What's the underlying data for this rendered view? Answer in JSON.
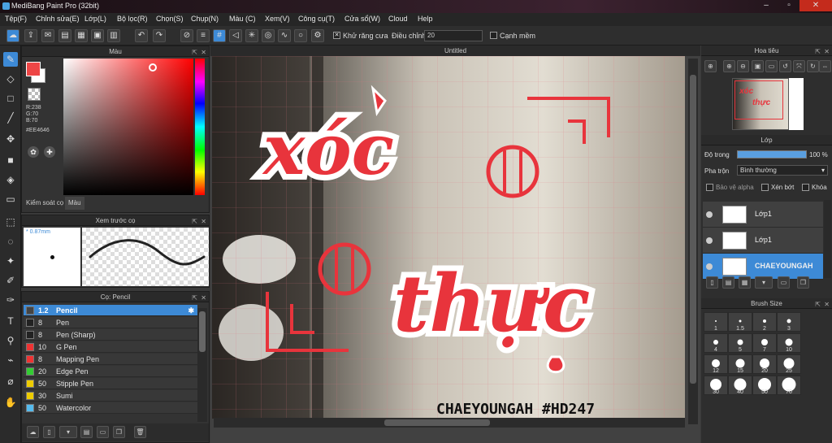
{
  "app": {
    "title": "MediBang Paint Pro (32bit)"
  },
  "menu": [
    "Tệp(F)",
    "Chỉnh sửa(E)",
    "Lớp(L)",
    "Bộ lọc(R)",
    "Chọn(S)",
    "Chụp(N)",
    "Màu (C)",
    "Xem(V)",
    "Công cụ(T)",
    "Cửa sổ(W)",
    "Cloud",
    "Help"
  ],
  "toolbar": {
    "antialias_label": "Khử răng cưa",
    "adjust_label": "Điều chỉnh",
    "adjust_value": "20",
    "sharp_edge_label": "Cạnh mềm"
  },
  "color_panel": {
    "title": "Màu",
    "r": "R:238",
    "g": "G:70",
    "b": "B:70",
    "hex": "#EE4646",
    "fg_color": "#EE4646",
    "tab_control": "Kiểm soát cọ",
    "tab_color": "Màu"
  },
  "brush_preview": {
    "title": "Xem trước cọ",
    "size": "0.87mm"
  },
  "brush_panel": {
    "title": "Cọ: Pencil",
    "brushes": [
      {
        "size": "1.2",
        "name": "Pencil",
        "color": "#444444"
      },
      {
        "size": "8",
        "name": "Pen",
        "color": "#222222"
      },
      {
        "size": "8",
        "name": "Pen (Sharp)",
        "color": "#222222"
      },
      {
        "size": "10",
        "name": "G Pen",
        "color": "#ee3333"
      },
      {
        "size": "8",
        "name": "Mapping Pen",
        "color": "#ee3333"
      },
      {
        "size": "20",
        "name": "Edge Pen",
        "color": "#33cc33"
      },
      {
        "size": "50",
        "name": "Stipple Pen",
        "color": "#eecc00"
      },
      {
        "size": "30",
        "name": "Sumi",
        "color": "#eecc00"
      },
      {
        "size": "50",
        "name": "Watercolor",
        "color": "#55bbee"
      }
    ]
  },
  "canvas": {
    "title": "Untitled",
    "word1": "xóc",
    "word2": "thực",
    "signature": "CHAEYOUNGAH #HD247",
    "accent": "#e8343c"
  },
  "navigator": {
    "title": "Hoa tiêu"
  },
  "layer_panel": {
    "title": "Lớp",
    "opacity_label": "Độ trong",
    "opacity_value": "100 %",
    "opacity": 1.0,
    "blend_label": "Pha trộn",
    "blend_value": "Bình thường",
    "protect_alpha": "Bảo vệ alpha",
    "clipping": "Xén bớt",
    "lock": "Khóa",
    "layers": [
      {
        "name": "Lớp1"
      },
      {
        "name": "Lớp1"
      },
      {
        "name": "CHAEYOUNGAH"
      }
    ]
  },
  "brush_size_panel": {
    "title": "Brush Size",
    "sizes": [
      "1",
      "1.5",
      "2",
      "3",
      "4",
      "5",
      "7",
      "10",
      "12",
      "15",
      "20",
      "25",
      "30",
      "40",
      "50",
      "70"
    ]
  }
}
